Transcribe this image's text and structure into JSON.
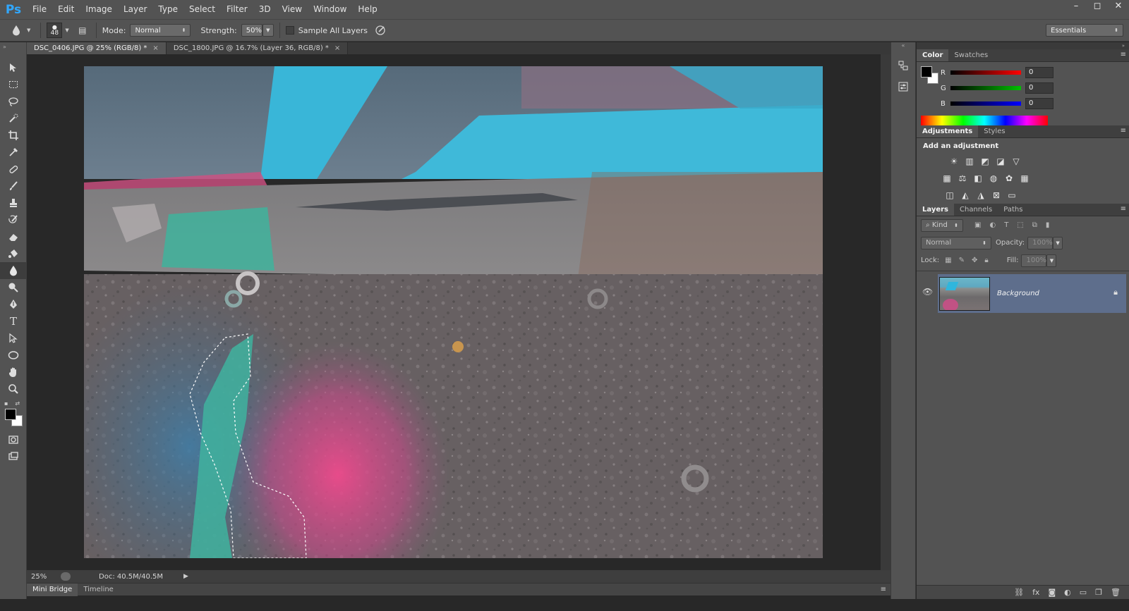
{
  "app": {
    "logo": "Ps"
  },
  "menu": [
    "File",
    "Edit",
    "Image",
    "Layer",
    "Type",
    "Select",
    "Filter",
    "3D",
    "View",
    "Window",
    "Help"
  ],
  "window_controls": {
    "minimize": "–",
    "restore": "◻",
    "close": "✕"
  },
  "options_bar": {
    "brush_size": "48",
    "mode_label": "Mode:",
    "mode_value": "Normal",
    "strength_label": "Strength:",
    "strength_value": "50%",
    "sample_all_layers": "Sample All Layers",
    "workspace": "Essentials"
  },
  "documents": [
    {
      "title": "DSC_0406.JPG @ 25% (RGB/8) *",
      "close": "×",
      "active": true
    },
    {
      "title": "DSC_1800.JPG @ 16.7% (Layer 36, RGB/8) *",
      "close": "×",
      "active": false
    }
  ],
  "status": {
    "zoom": "25%",
    "doc": "Doc: 40.5M/40.5M"
  },
  "bottom_tabs": [
    "Mini Bridge",
    "Timeline"
  ],
  "color_panel": {
    "tabs": [
      "Color",
      "Swatches"
    ],
    "channels": [
      {
        "label": "R",
        "value": "0",
        "color": "#ff0000"
      },
      {
        "label": "G",
        "value": "0",
        "color": "#00c000"
      },
      {
        "label": "B",
        "value": "0",
        "color": "#0000ff"
      }
    ]
  },
  "adjustments_panel": {
    "tabs": [
      "Adjustments",
      "Styles"
    ],
    "title": "Add an adjustment"
  },
  "layers_panel": {
    "tabs": [
      "Layers",
      "Channels",
      "Paths"
    ],
    "kind": "Kind",
    "blend_mode": "Normal",
    "opacity_label": "Opacity:",
    "opacity_value": "100%",
    "lock_label": "Lock:",
    "fill_label": "Fill:",
    "fill_value": "100%",
    "layers": [
      {
        "name": "Background",
        "locked": true,
        "visible": true
      }
    ]
  },
  "colors": {
    "menubar": "#535353",
    "canvas_bg": "#282828",
    "selected_layer": "#5e6e8c",
    "accent": "#31a8ff"
  }
}
